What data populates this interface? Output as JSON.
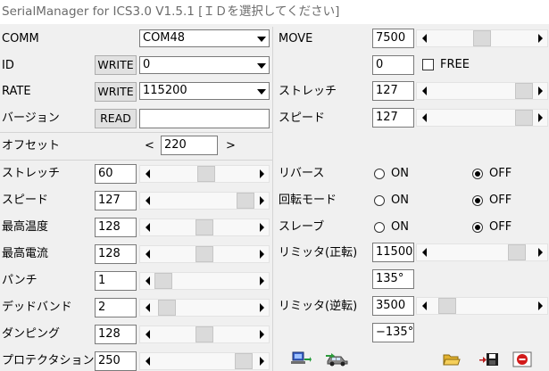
{
  "title": "SerialManager for ICS3.0 V1.5.1 [ＩＤを選択してください]",
  "comm": {
    "label": "COMM",
    "value": "COM48"
  },
  "id": {
    "label": "ID",
    "button": "WRITE",
    "value": "0"
  },
  "rate": {
    "label": "RATE",
    "button": "WRITE",
    "value": "115200"
  },
  "version": {
    "label": "バージョン",
    "button": "READ",
    "value": ""
  },
  "offset": {
    "label": "オフセット",
    "left_arrow": "<",
    "value": "220",
    "right_arrow": ">"
  },
  "params": [
    {
      "label": "ストレッチ",
      "value": "60",
      "level": 0.52
    },
    {
      "label": "スピード",
      "value": "127",
      "level": 1.0
    },
    {
      "label": "最高温度",
      "value": "128",
      "level": 0.5
    },
    {
      "label": "最高電流",
      "value": "128",
      "level": 0.5
    },
    {
      "label": "パンチ",
      "value": "1",
      "level": 0.0
    },
    {
      "label": "デッドバンド",
      "value": "2",
      "level": 0.04
    },
    {
      "label": "ダンピング",
      "value": "128",
      "level": 0.5
    },
    {
      "label": "プロテクタション",
      "value": "250",
      "level": 0.98
    }
  ],
  "move": {
    "label": "MOVE",
    "value": "7500",
    "level": 0.5
  },
  "move2": {
    "value": "0",
    "free_label": "FREE",
    "free_checked": false
  },
  "r_stretch": {
    "label": "ストレッチ",
    "value": "127",
    "level": 1.0
  },
  "r_speed": {
    "label": "スピード",
    "value": "127",
    "level": 1.0
  },
  "options": [
    {
      "label": "リバース",
      "on_label": "ON",
      "off_label": "OFF",
      "selected": "OFF"
    },
    {
      "label": "回転モード",
      "on_label": "ON",
      "off_label": "OFF",
      "selected": "OFF"
    },
    {
      "label": "スレーブ",
      "on_label": "ON",
      "off_label": "OFF",
      "selected": "OFF"
    }
  ],
  "limit_fwd": {
    "label": "リミッタ(正転)",
    "value": "11500",
    "level": 0.92,
    "angle": "135°"
  },
  "limit_rev": {
    "label": "リミッタ(逆転)",
    "value": "3500",
    "level": 0.08,
    "angle": "−135°"
  },
  "toolbar_icons": [
    "serial-connect-icon",
    "car-icon",
    "folder-open-icon",
    "save-icon",
    "stop-icon"
  ]
}
